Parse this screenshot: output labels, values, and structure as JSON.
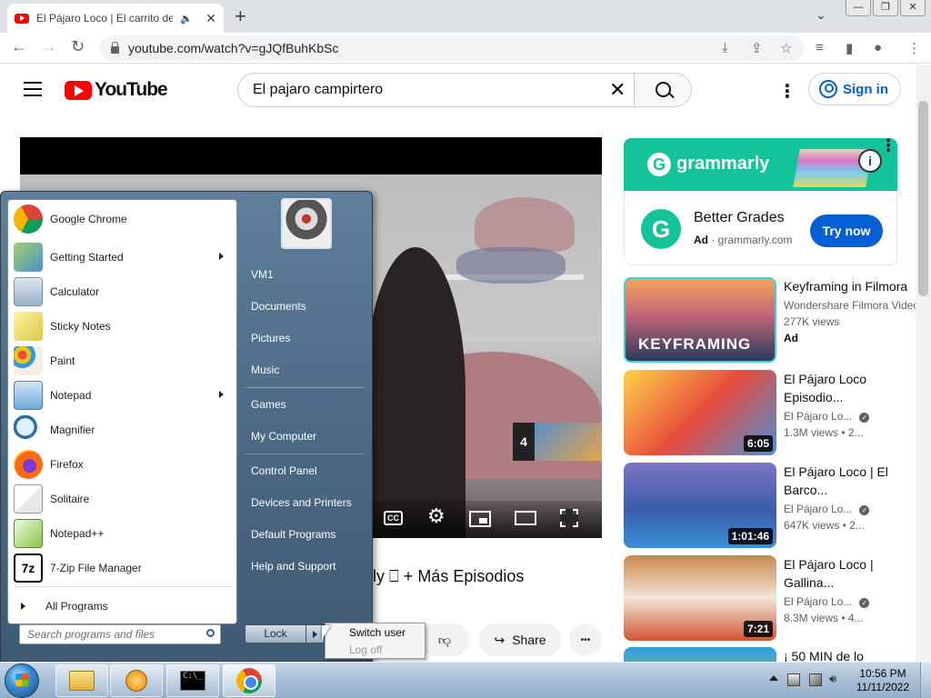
{
  "browser": {
    "tab_title": "El Pájaro Loco | El carrito de",
    "tab_close": "✕",
    "new_tab": "+",
    "url": "youtube.com/watch?v=gJQfBuhKbSc",
    "window_controls": [
      "—",
      "❐",
      "✕"
    ]
  },
  "youtube": {
    "logo_text": "YouTube",
    "search_query": "El pajaro campirtero",
    "sign_in": "Sign in",
    "video_title_partial": "ly ⎕ + Más Episodios",
    "next_card_number": "4",
    "cc_label": "CC",
    "share_label": "Share",
    "more_label": "•••"
  },
  "ad": {
    "brand": "grammarly",
    "headline": "Better Grades",
    "ad_label": "Ad",
    "domain": "grammarly.com",
    "cta": "Try now"
  },
  "recommendations": [
    {
      "title": "Keyframing in Filmora",
      "channel": "Wondershare Filmora Video",
      "views": "277K views",
      "ad": "Ad",
      "thumb_text": "KEYFRAMING",
      "duration": ""
    },
    {
      "title": "El Pájaro Loco Episodio...",
      "channel": "El Pájaro Lo...",
      "views": "1.3M views  •  2...",
      "duration": "6:05"
    },
    {
      "title": "El Pájaro Loco | El Barco...",
      "channel": "El Pájaro Lo...",
      "views": "647K views  •  2...",
      "duration": "1:01:46"
    },
    {
      "title": "El Pájaro Loco | Gallina...",
      "channel": "El Pájaro Lo...",
      "views": "8.3M views  •  4...",
      "duration": "7:21"
    },
    {
      "title": "¡ 50 MIN de lo",
      "channel": "",
      "views": "",
      "duration": ""
    }
  ],
  "start_menu": {
    "programs": [
      {
        "label": "Google Chrome",
        "icon": "chrome-icon",
        "submenu": false
      },
      {
        "label": "Getting Started",
        "icon": "getting-started-icon",
        "submenu": true
      },
      {
        "label": "Calculator",
        "icon": "calculator-icon",
        "submenu": false
      },
      {
        "label": "Sticky Notes",
        "icon": "sticky-notes-icon",
        "submenu": false
      },
      {
        "label": "Paint",
        "icon": "paint-icon",
        "submenu": false
      },
      {
        "label": "Notepad",
        "icon": "notepad-icon",
        "submenu": true
      },
      {
        "label": "Magnifier",
        "icon": "magnifier-icon",
        "submenu": false
      },
      {
        "label": "Firefox",
        "icon": "firefox-icon",
        "submenu": false
      },
      {
        "label": "Solitaire",
        "icon": "solitaire-icon",
        "submenu": false
      },
      {
        "label": "Notepad++",
        "icon": "notepadpp-icon",
        "submenu": false
      },
      {
        "label": "7-Zip File Manager",
        "icon": "7zip-icon",
        "submenu": false
      }
    ],
    "all_programs": "All Programs",
    "search_placeholder": "Search programs and files",
    "right_items": [
      "VM1",
      "Documents",
      "Pictures",
      "Music",
      "Games",
      "My Computer",
      "Control Panel",
      "Devices and Printers",
      "Default Programs",
      "Help and Support"
    ],
    "lock": "Lock",
    "power_menu": [
      "Switch user",
      "Log off"
    ]
  },
  "taskbar": {
    "time": "10:56 PM",
    "date": "11/11/2022",
    "cmd_text": "C:\\_"
  }
}
